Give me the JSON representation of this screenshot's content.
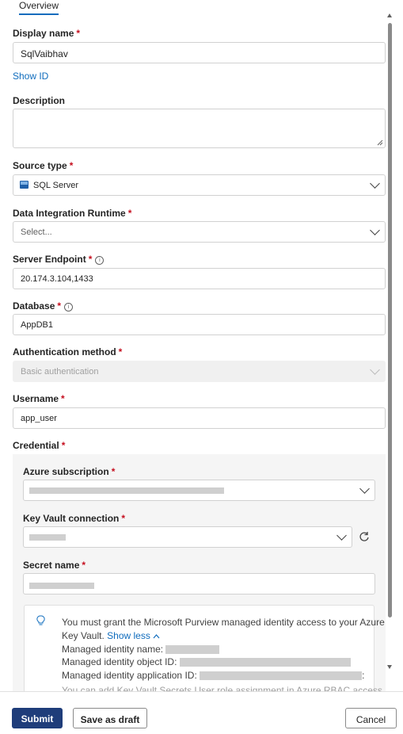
{
  "tabs": {
    "overview": "Overview"
  },
  "fields": {
    "display_name": {
      "label": "Display name",
      "value": "SqlVaibhav"
    },
    "show_id": "Show ID",
    "description": {
      "label": "Description",
      "value": ""
    },
    "source_type": {
      "label": "Source type",
      "value": "SQL Server",
      "icon": "sql-server-icon"
    },
    "runtime": {
      "label": "Data Integration Runtime",
      "placeholder": "Select..."
    },
    "server_endpoint": {
      "label": "Server Endpoint",
      "value": "20.174.3.104,1433"
    },
    "database": {
      "label": "Database",
      "value": "AppDB1"
    },
    "auth_method": {
      "label": "Authentication method",
      "value": "Basic authentication"
    },
    "username": {
      "label": "Username",
      "value": "app_user"
    },
    "credential": {
      "label": "Credential"
    },
    "azure_subscription": {
      "label": "Azure subscription"
    },
    "key_vault": {
      "label": "Key Vault connection"
    },
    "secret_name": {
      "label": "Secret name"
    }
  },
  "notice": {
    "line1": "You must grant the Microsoft Purview managed identity access to your Azure",
    "line2": "Key Vault.",
    "show_less": "Show less",
    "mi_name": "Managed identity name:",
    "mi_object_id": "Managed identity object ID:",
    "mi_app_id": "Managed identity application ID:",
    "trailing": "You can add Key Vault Secrets User role assignment in Azure RBAC access",
    "colon": ":"
  },
  "footer": {
    "submit": "Submit",
    "save_draft": "Save as draft",
    "cancel": "Cancel"
  },
  "colors": {
    "primary": "#0f6cbd",
    "submit_bg": "#1f3d7a",
    "required": "#c50f1f"
  }
}
